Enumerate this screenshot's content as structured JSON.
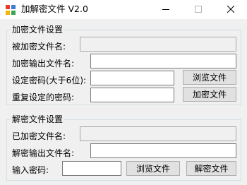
{
  "window": {
    "title": "加解密文件 V2.0",
    "icon": "app-icon",
    "controls": [
      "minimize-icon",
      "maximize-icon",
      "close-icon"
    ]
  },
  "encrypt_group": {
    "legend": "加密文件设置",
    "source_label": "被加密文件名:",
    "source_value": "",
    "output_label": "加密输出文件名:",
    "output_value": "",
    "password_label": "设定密码(大于6位):",
    "password_value": "",
    "confirm_label": "重复设定的密码:",
    "confirm_value": "",
    "browse_button": "浏览文件",
    "encrypt_button": "加密文件"
  },
  "decrypt_group": {
    "legend": "解密文件设置",
    "source_label": "已加密文件名:",
    "source_value": "",
    "output_label": "解密输出文件名:",
    "output_value": "",
    "password_label": "输入密码:",
    "password_value": "",
    "browse_button": "浏览文件",
    "decrypt_button": "解密文件"
  }
}
